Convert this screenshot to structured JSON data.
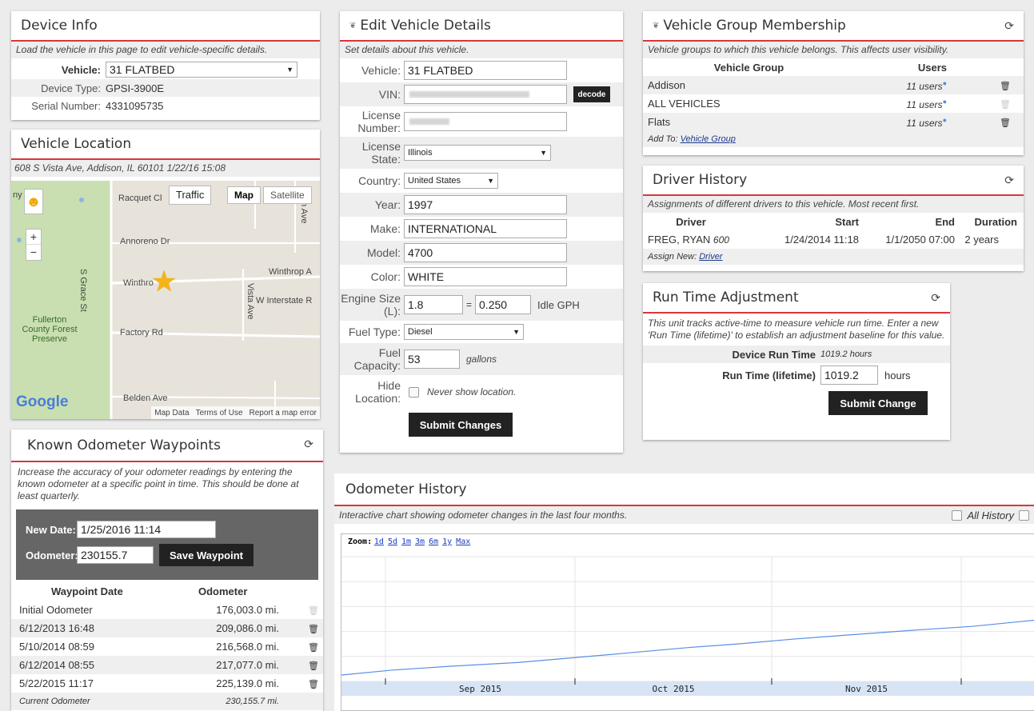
{
  "device_info": {
    "title": "Device Info",
    "desc": "Load the vehicle in this page to edit vehicle-specific details.",
    "vehicle_label": "Vehicle:",
    "vehicle_value": "31 FLATBED",
    "device_type_label": "Device Type:",
    "device_type": "GPSI-3900E",
    "serial_label": "Serial Number:",
    "serial": "4331095735"
  },
  "vehicle_location": {
    "title": "Vehicle Location",
    "address": "608 S Vista Ave, Addison, IL 60101 1/22/16 15:08",
    "map": {
      "traffic": "Traffic",
      "map": "Map",
      "satellite": "Satellite",
      "zoom_in": "+",
      "zoom_out": "−",
      "streets": {
        "racquet": "Racquet Cl",
        "annoreno": "Annoreno Dr",
        "winthrop_w": "Winthro",
        "winthrop_e": "Winthrop A",
        "interstate": "W Interstate R",
        "factory": "Factory Rd",
        "belden": "Belden Ave",
        "grace": "S Grace St",
        "vista": "Vista Ave",
        "on_ave": "on Ave",
        "fullerton": "Fullerton County Forest Preserve",
        "edge": "ny"
      },
      "google": "Google",
      "footer_map_data": "Map Data",
      "footer_terms": "Terms of Use",
      "footer_report": "Report a map error"
    }
  },
  "odometer_waypoints": {
    "title": "Known Odometer Waypoints",
    "desc": "Increase the accuracy of your odometer readings by entering the known odometer at a specific point in time. This should be done at least quarterly.",
    "new_date_label": "New Date:",
    "new_date_value": "1/25/2016 11:14",
    "odometer_label": "Odometer:",
    "odometer_value": "230155.7",
    "save_button": "Save Waypoint",
    "col_date": "Waypoint Date",
    "col_odometer": "Odometer",
    "rows": [
      {
        "date": "Initial Odometer",
        "odometer": "176,003.0 mi.",
        "deletable": false
      },
      {
        "date": "6/12/2013 16:48",
        "odometer": "209,086.0 mi.",
        "deletable": true
      },
      {
        "date": "5/10/2014 08:59",
        "odometer": "216,568.0 mi.",
        "deletable": true
      },
      {
        "date": "6/12/2014 08:55",
        "odometer": "217,077.0 mi.",
        "deletable": true
      },
      {
        "date": "5/22/2015 11:17",
        "odometer": "225,139.0 mi.",
        "deletable": true
      }
    ],
    "current_label": "Current Odometer",
    "current_value": "230,155.7 mi."
  },
  "edit_vehicle": {
    "title": "Edit Vehicle Details",
    "desc": "Set details about this vehicle.",
    "vehicle_label": "Vehicle:",
    "vehicle_value": "31 FLATBED",
    "vin_label": "VIN:",
    "decode_button": "decode",
    "license_number_label": "License Number:",
    "license_state_label": "License State:",
    "license_state_value": "Illinois",
    "country_label": "Country:",
    "country_value": "United States",
    "year_label": "Year:",
    "year_value": "1997",
    "make_label": "Make:",
    "make_value": "INTERNATIONAL",
    "model_label": "Model:",
    "model_value": "4700",
    "color_label": "Color:",
    "color_value": "WHITE",
    "engine_label": "Engine Size (L):",
    "engine_value": "1.8",
    "equals": "=",
    "idle_value": "0.250",
    "idle_unit": "Idle GPH",
    "fuel_type_label": "Fuel Type:",
    "fuel_type_value": "Diesel",
    "fuel_capacity_label": "Fuel Capacity:",
    "fuel_capacity_value": "53",
    "fuel_capacity_unit": "gallons",
    "hide_location_label": "Hide Location:",
    "hide_location_text": "Never show location.",
    "submit_button": "Submit Changes"
  },
  "group_membership": {
    "title": "Vehicle Group Membership",
    "desc": "Vehicle groups to which this vehicle belongs. This affects user visibility.",
    "col_group": "Vehicle Group",
    "col_users": "Users",
    "rows": [
      {
        "group": "Addison",
        "users": "11 users",
        "deletable": true
      },
      {
        "group": "ALL VEHICLES",
        "users": "11 users",
        "deletable": false
      },
      {
        "group": "Flats",
        "users": "11 users",
        "deletable": true
      }
    ],
    "add_to_label": "Add To:",
    "add_to_link": "Vehicle Group"
  },
  "driver_history": {
    "title": "Driver History",
    "desc": "Assignments of different drivers to this vehicle. Most recent first.",
    "col_driver": "Driver",
    "col_start": "Start",
    "col_end": "End",
    "col_duration": "Duration",
    "rows": [
      {
        "driver": "FREG, RYAN",
        "driver_id": "600",
        "start": "1/24/2014 11:18",
        "end": "1/1/2050 07:00",
        "duration": "2 years"
      }
    ],
    "assign_label": "Assign New:",
    "assign_link": "Driver"
  },
  "run_time": {
    "title": "Run Time Adjustment",
    "desc": "This unit tracks active-time to measure vehicle run time. Enter a new 'Run Time (lifetime)' to establish an adjustment baseline for this value.",
    "device_run_label": "Device Run Time",
    "device_run_value": "1019.2 hours",
    "lifetime_label": "Run Time (lifetime)",
    "lifetime_value": "1019.2",
    "lifetime_unit": "hours",
    "submit_button": "Submit Change"
  },
  "odometer_history": {
    "title": "Odometer History",
    "desc": "Interactive chart showing odometer changes in the last four months.",
    "all_history": "All History",
    "zoom_label": "Zoom:",
    "zoom_links": [
      "1d",
      "5d",
      "1m",
      "3m",
      "6m",
      "1y",
      "Max"
    ],
    "colors": {
      "line": "#5b8ee6",
      "axis_band": "#d6e4f5",
      "accent": "#d9363e"
    }
  },
  "chart_data": {
    "type": "line",
    "x_ticks": [
      "Sep 2015",
      "Oct 2015",
      "Nov 2015"
    ],
    "series": [
      {
        "x": [
          "2015-08-01",
          "2015-08-10",
          "2015-08-20",
          "2015-09-01",
          "2015-09-10",
          "2015-09-20",
          "2015-10-01",
          "2015-10-10",
          "2015-10-20",
          "2015-11-01",
          "2015-11-10",
          "2015-11-20",
          "2015-12-01"
        ],
        "values": [
          0.0,
          0.08,
          0.14,
          0.2,
          0.27,
          0.35,
          0.44,
          0.5,
          0.58,
          0.66,
          0.72,
          0.78,
          0.88
        ]
      }
    ]
  }
}
